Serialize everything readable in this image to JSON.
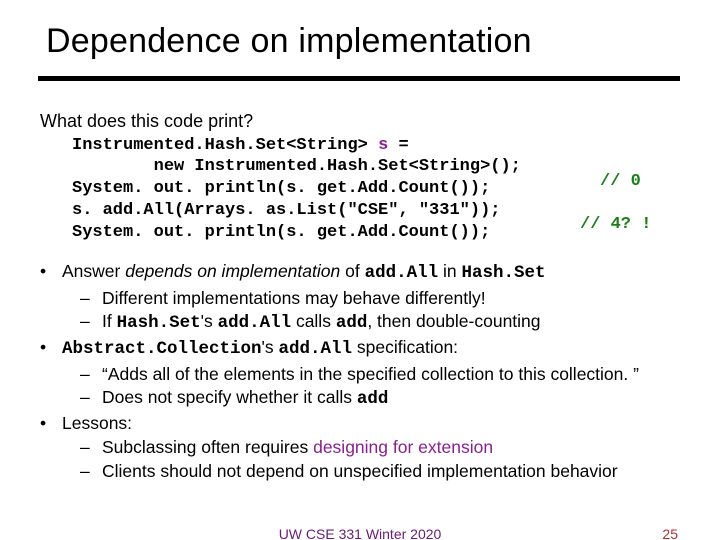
{
  "title": "Dependence on implementation",
  "question": "What does this code print?",
  "code": {
    "l1a": "Instrumented.Hash.Set<String> ",
    "l1b": "s",
    "l1c": " =",
    "l2": "        new Instrumented.Hash.Set<String>();",
    "l3": "System. out. println(s. get.Add.Count());",
    "l4": "s. add.All(Arrays. as.List(\"CSE\", \"331\"));",
    "l5": "System. out. println(s. get.Add.Count());",
    "cmt0": "// 0",
    "cmt1": "// 4? !"
  },
  "b1": {
    "lead": "Answer ",
    "emph": "depends on implementation",
    "mid": " of ",
    "code1": "add.All",
    "mid2": " in ",
    "code2": "Hash.Set"
  },
  "b1s1": "Different implementations may behave differently!",
  "b1s2": {
    "a": "If ",
    "code1": "Hash.Set",
    "b": "'s ",
    "code2": "add.All",
    "c": " calls ",
    "code3": "add",
    "d": ", then double-counting"
  },
  "b2": {
    "code1": "Abstract.Collection",
    "a": "'s ",
    "code2": "add.All",
    "b": " specification:"
  },
  "b2s1": "“Adds all of the elements in the specified collection to this collection. ”",
  "b2s2": {
    "a": "Does not specify whether it calls ",
    "code1": "add"
  },
  "b3": "Lessons:",
  "b3s1": {
    "a": "Subclassing often requires ",
    "design": "designing for extension"
  },
  "b3s2": "Clients should not depend on unspecified implementation behavior",
  "footer": {
    "course": "UW CSE 331 Winter 2020",
    "page": "25"
  }
}
